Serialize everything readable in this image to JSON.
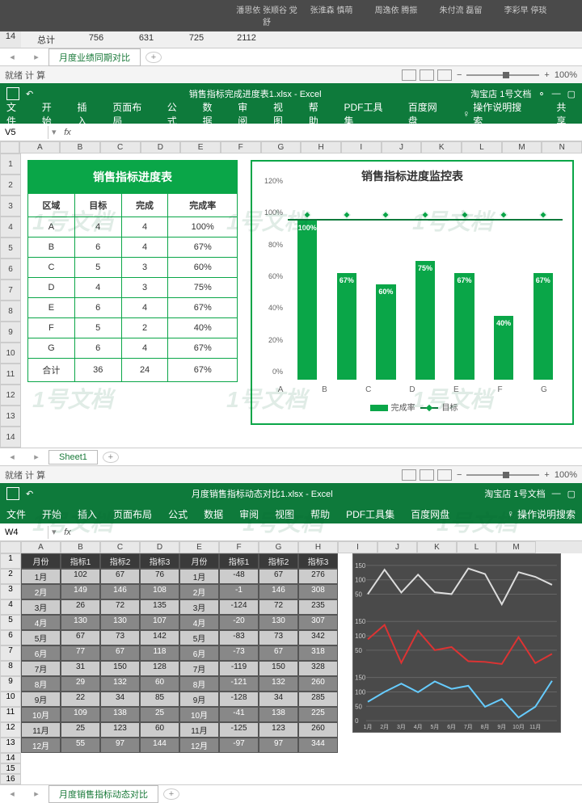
{
  "win1": {
    "names": [
      "潘思依 张顺谷 党舒",
      "张淮森 慎萌",
      "周逸依 腾振",
      "朱付流 磊留",
      "李彩早 停琰"
    ],
    "totals_label": "总计",
    "totals": [
      "756",
      "631",
      "725",
      "2112"
    ],
    "row_num": "14",
    "sheet_tab": "月度业绩同期对比",
    "status_left": "就绪   计 算",
    "zoom": "100%"
  },
  "win2": {
    "title": "销售指标完成进度表1.xlsx  -  Excel",
    "shop": "淘宝店 1号文档",
    "ribbon": [
      "文件",
      "开始",
      "插入",
      "页面布局",
      "公式",
      "数据",
      "审阅",
      "视图",
      "帮助",
      "PDF工具集",
      "百度网盘"
    ],
    "search": "操作说明搜索",
    "share": "共享",
    "namebox": "V5",
    "cols": [
      "A",
      "B",
      "C",
      "D",
      "E",
      "F",
      "G",
      "H",
      "I",
      "J",
      "K",
      "L",
      "M",
      "N"
    ],
    "rows": [
      "1",
      "2",
      "3",
      "4",
      "5",
      "6",
      "7",
      "8",
      "9",
      "10",
      "11",
      "12",
      "13",
      "14"
    ],
    "sheet_tab": "Sheet1",
    "status_left": "就绪   计 算",
    "zoom": "100%",
    "table": {
      "title": "销售指标进度表",
      "headers": [
        "区域",
        "目标",
        "完成",
        "完成率"
      ],
      "rows": [
        [
          "A",
          "4",
          "4",
          "100%"
        ],
        [
          "B",
          "6",
          "4",
          "67%"
        ],
        [
          "C",
          "5",
          "3",
          "60%"
        ],
        [
          "D",
          "4",
          "3",
          "75%"
        ],
        [
          "E",
          "6",
          "4",
          "67%"
        ],
        [
          "F",
          "5",
          "2",
          "40%"
        ],
        [
          "G",
          "6",
          "4",
          "67%"
        ],
        [
          "合计",
          "36",
          "24",
          "67%"
        ]
      ]
    }
  },
  "chart_data": {
    "type": "bar",
    "title": "销售指标进度监控表",
    "categories": [
      "A",
      "B",
      "C",
      "D",
      "E",
      "F",
      "G"
    ],
    "series": [
      {
        "name": "完成率",
        "type": "bar",
        "values": [
          100,
          67,
          60,
          75,
          67,
          40,
          67
        ]
      },
      {
        "name": "目标",
        "type": "line",
        "values": [
          100,
          100,
          100,
          100,
          100,
          100,
          100
        ]
      }
    ],
    "ylabel": "",
    "ylim": [
      0,
      120
    ],
    "yticks": [
      "0%",
      "20%",
      "40%",
      "60%",
      "80%",
      "100%",
      "120%"
    ],
    "legend": [
      "完成率",
      "目标"
    ]
  },
  "win3": {
    "title": "月度销售指标动态对比1.xlsx  -  Excel",
    "shop": "淘宝店 1号文档",
    "ribbon": [
      "文件",
      "开始",
      "插入",
      "页面布局",
      "公式",
      "数据",
      "审阅",
      "视图",
      "帮助",
      "PDF工具集",
      "百度网盘"
    ],
    "search": "操作说明搜索",
    "namebox": "W4",
    "cols": [
      "A",
      "B",
      "C",
      "D",
      "E",
      "F",
      "G",
      "H",
      "I",
      "J",
      "K",
      "L",
      "M"
    ],
    "rows": [
      "1",
      "2",
      "3",
      "4",
      "5",
      "6",
      "7",
      "8",
      "9",
      "10",
      "11",
      "12",
      "13",
      "14",
      "15",
      "16"
    ],
    "headers": [
      "月份",
      "指标1",
      "指标2",
      "指标3",
      "月份",
      "指标1",
      "指标2",
      "指标3"
    ],
    "data": [
      [
        "1月",
        "102",
        "67",
        "76",
        "1月",
        "-48",
        "67",
        "276"
      ],
      [
        "2月",
        "149",
        "146",
        "108",
        "2月",
        "-1",
        "146",
        "308"
      ],
      [
        "3月",
        "26",
        "72",
        "135",
        "3月",
        "-124",
        "72",
        "235"
      ],
      [
        "4月",
        "130",
        "130",
        "107",
        "4月",
        "-20",
        "130",
        "307"
      ],
      [
        "5月",
        "67",
        "73",
        "142",
        "5月",
        "-83",
        "73",
        "342"
      ],
      [
        "6月",
        "77",
        "67",
        "118",
        "6月",
        "-73",
        "67",
        "318"
      ],
      [
        "7月",
        "31",
        "150",
        "128",
        "7月",
        "-119",
        "150",
        "328"
      ],
      [
        "8月",
        "29",
        "132",
        "60",
        "8月",
        "-121",
        "132",
        "260"
      ],
      [
        "9月",
        "22",
        "34",
        "85",
        "9月",
        "-128",
        "34",
        "285"
      ],
      [
        "10月",
        "109",
        "138",
        "25",
        "10月",
        "-41",
        "138",
        "225"
      ],
      [
        "11月",
        "25",
        "123",
        "60",
        "11月",
        "-125",
        "123",
        "260"
      ],
      [
        "12月",
        "55",
        "97",
        "144",
        "12月",
        "-97",
        "97",
        "344"
      ]
    ],
    "sheet_tab": "月度销售指标动态对比",
    "chart_xticks": [
      "1月",
      "2月",
      "3月",
      "4月",
      "5月",
      "6月",
      "7月",
      "8月",
      "9月",
      "10月",
      "11月"
    ],
    "chart_yticks_top": [
      "50",
      "100",
      "150"
    ],
    "chart_yticks_mid": [
      "50",
      "100",
      "150"
    ],
    "chart_yticks_bot": [
      "0",
      "50",
      "100",
      "150"
    ]
  }
}
